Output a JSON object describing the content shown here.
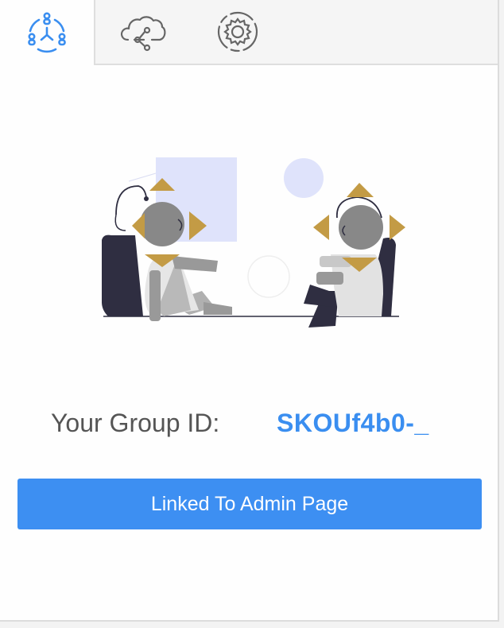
{
  "tabs": [
    {
      "icon": "group-network-icon",
      "active": true
    },
    {
      "icon": "cloud-share-icon",
      "active": false
    },
    {
      "icon": "settings-gear-icon",
      "active": false
    }
  ],
  "group": {
    "label": "Your Group ID:",
    "id": "SKOUf4b0-_"
  },
  "admin_button": {
    "label": "Linked To Admin Page"
  },
  "colors": {
    "accent": "#3d8ff2",
    "id_text": "#3a8ef0",
    "label_text": "#555555",
    "tab_icon_active": "#3a8ef0",
    "tab_icon_inactive": "#666666"
  }
}
